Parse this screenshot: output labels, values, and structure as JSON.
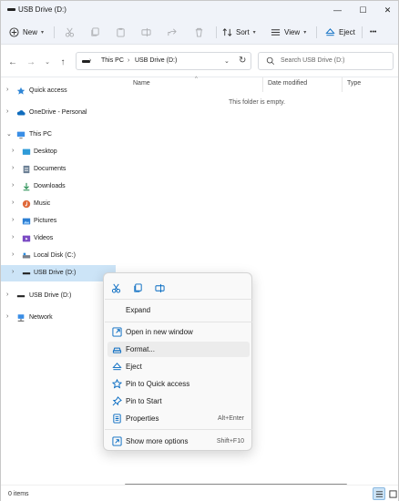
{
  "window": {
    "title": "USB Drive (D:)",
    "controls": {
      "minimize": "—",
      "maximize": "☐",
      "close": "✕"
    }
  },
  "toolbar": {
    "new_label": "New",
    "sort_label": "Sort",
    "view_label": "View",
    "eject_label": "Eject",
    "more_label": "•••"
  },
  "address": {
    "crumbs": [
      "This PC",
      "USB Drive (D:)"
    ],
    "search_placeholder": "Search USB Drive (D:)"
  },
  "sidebar": {
    "items": [
      {
        "label": "Quick access",
        "icon": "star-icon"
      },
      {
        "label": "OneDrive - Personal",
        "icon": "cloud-icon"
      },
      {
        "label": "This PC",
        "icon": "computer-icon"
      },
      {
        "label": "Desktop",
        "icon": "desktop-folder-icon"
      },
      {
        "label": "Documents",
        "icon": "documents-folder-icon"
      },
      {
        "label": "Downloads",
        "icon": "downloads-icon"
      },
      {
        "label": "Music",
        "icon": "music-icon"
      },
      {
        "label": "Pictures",
        "icon": "pictures-icon"
      },
      {
        "label": "Videos",
        "icon": "videos-icon"
      },
      {
        "label": "Local Disk (C:)",
        "icon": "local-disk-icon"
      },
      {
        "label": "USB Drive (D:)",
        "icon": "usb-drive-icon"
      },
      {
        "label": "USB Drive (D:)",
        "icon": "usb-drive-icon"
      },
      {
        "label": "Network",
        "icon": "network-icon"
      }
    ]
  },
  "content": {
    "columns": [
      "Name",
      "Date modified",
      "Type"
    ],
    "empty_message": "This folder is empty."
  },
  "status": {
    "items_count": "0 items"
  },
  "context_menu": {
    "quick_actions": [
      "cut-icon",
      "copy-icon",
      "rename-icon"
    ],
    "items": [
      {
        "label": "Expand",
        "shortcut": ""
      },
      {
        "label": "Open in new window",
        "shortcut": ""
      },
      {
        "label": "Format...",
        "shortcut": ""
      },
      {
        "label": "Eject",
        "shortcut": ""
      },
      {
        "label": "Pin to Quick access",
        "shortcut": ""
      },
      {
        "label": "Pin to Start",
        "shortcut": ""
      },
      {
        "label": "Properties",
        "shortcut": "Alt+Enter"
      },
      {
        "label": "Show more options",
        "shortcut": "Shift+F10"
      }
    ]
  },
  "colors": {
    "accent": "#0067c0",
    "selection": "#cce4f7",
    "folder": "#f4c22b"
  }
}
